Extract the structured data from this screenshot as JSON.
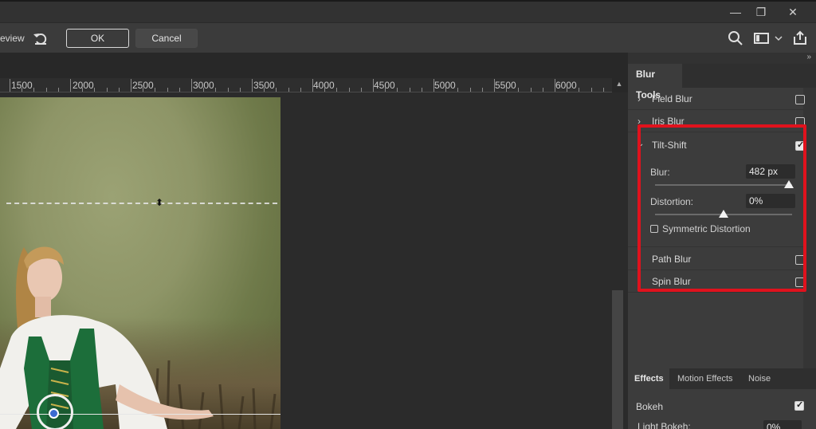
{
  "window": {
    "minimize_glyph": "—",
    "restore_glyph": "❐",
    "close_glyph": "✕"
  },
  "options_bar": {
    "preview_label": "eview",
    "ok_label": "OK",
    "cancel_label": "Cancel"
  },
  "ruler": {
    "ticks": [
      "1500",
      "2000",
      "2500",
      "3000",
      "3500",
      "4000",
      "4500",
      "5000",
      "5500",
      "6000"
    ]
  },
  "panel": {
    "title": "Blur Tools",
    "items": {
      "field_blur": {
        "label": "Field Blur",
        "checked": false
      },
      "iris_blur": {
        "label": "Iris Blur",
        "checked": false
      },
      "tilt_shift": {
        "label": "Tilt-Shift",
        "checked": true
      },
      "path_blur": {
        "label": "Path Blur",
        "checked": false
      },
      "spin_blur": {
        "label": "Spin Blur",
        "checked": false
      }
    },
    "tilt_shift": {
      "blur_label": "Blur:",
      "blur_value": "482 px",
      "distortion_label": "Distortion:",
      "distortion_value": "0%",
      "symmetric_label": "Symmetric Distortion",
      "symmetric_checked": false
    },
    "effects_tabs": [
      "Effects",
      "Motion Effects",
      "Noise"
    ],
    "bokeh": {
      "label": "Bokeh",
      "checked": true
    },
    "light_bokeh": {
      "label": "Light Bokeh:",
      "value": "0%"
    }
  },
  "colors": {
    "highlight": "#e0121d",
    "panel_bg": "#3c3c3c",
    "pin_center": "#3b6bd1"
  }
}
